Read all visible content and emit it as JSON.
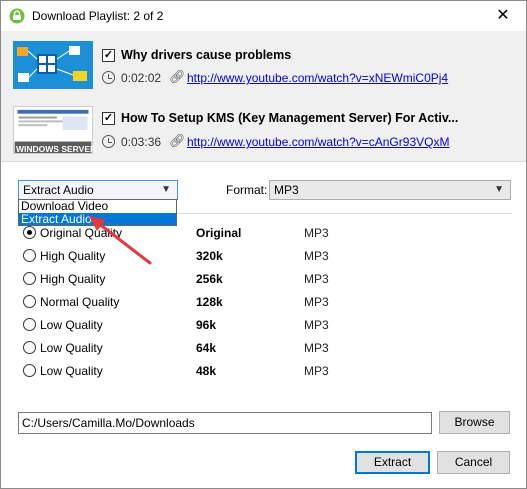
{
  "window": {
    "title": "Download Playlist: 2 of 2",
    "close_glyph": "✕"
  },
  "videos": [
    {
      "checked": true,
      "title": "Why drivers cause problems",
      "duration": "0:02:02",
      "url": "http://www.youtube.com/watch?v=xNEWmiC0Pj4",
      "thumbnail": "drivers-diagram-thumbnail"
    },
    {
      "checked": true,
      "title": "How To Setup KMS (Key Management Server) For Activ...",
      "duration": "0:03:36",
      "url": "http://www.youtube.com/watch?v=cAnGr93VQxM",
      "thumbnail": "windows-server-thumbnail",
      "thumbnail_caption": "WINDOWS SERVER"
    }
  ],
  "mode": {
    "selected": "Extract Audio",
    "options": [
      "Download Video",
      "Extract Audio"
    ],
    "highlighted_option": "Extract Audio"
  },
  "format": {
    "label": "Format:",
    "selected": "MP3"
  },
  "qualities": [
    {
      "name": "Original Quality",
      "bitrate": "Original",
      "format": "MP3",
      "selected": true
    },
    {
      "name": "High Quality",
      "bitrate": "320k",
      "format": "MP3",
      "selected": false
    },
    {
      "name": "High Quality",
      "bitrate": "256k",
      "format": "MP3",
      "selected": false
    },
    {
      "name": "Normal Quality",
      "bitrate": "128k",
      "format": "MP3",
      "selected": false
    },
    {
      "name": "Low Quality",
      "bitrate": "96k",
      "format": "MP3",
      "selected": false
    },
    {
      "name": "Low Quality",
      "bitrate": "64k",
      "format": "MP3",
      "selected": false
    },
    {
      "name": "Low Quality",
      "bitrate": "48k",
      "format": "MP3",
      "selected": false
    }
  ],
  "output": {
    "path": "C:/Users/Camilla.Mo/Downloads",
    "browse_label": "Browse"
  },
  "actions": {
    "extract_label": "Extract",
    "cancel_label": "Cancel"
  },
  "colors": {
    "accent": "#0078d7",
    "link": "#0000ee",
    "annotation_arrow": "#e0393e"
  },
  "icons": {
    "app": "app-logo-icon",
    "duration": "clock-icon",
    "url": "link-icon",
    "dropdown": "chevron-down-icon"
  }
}
